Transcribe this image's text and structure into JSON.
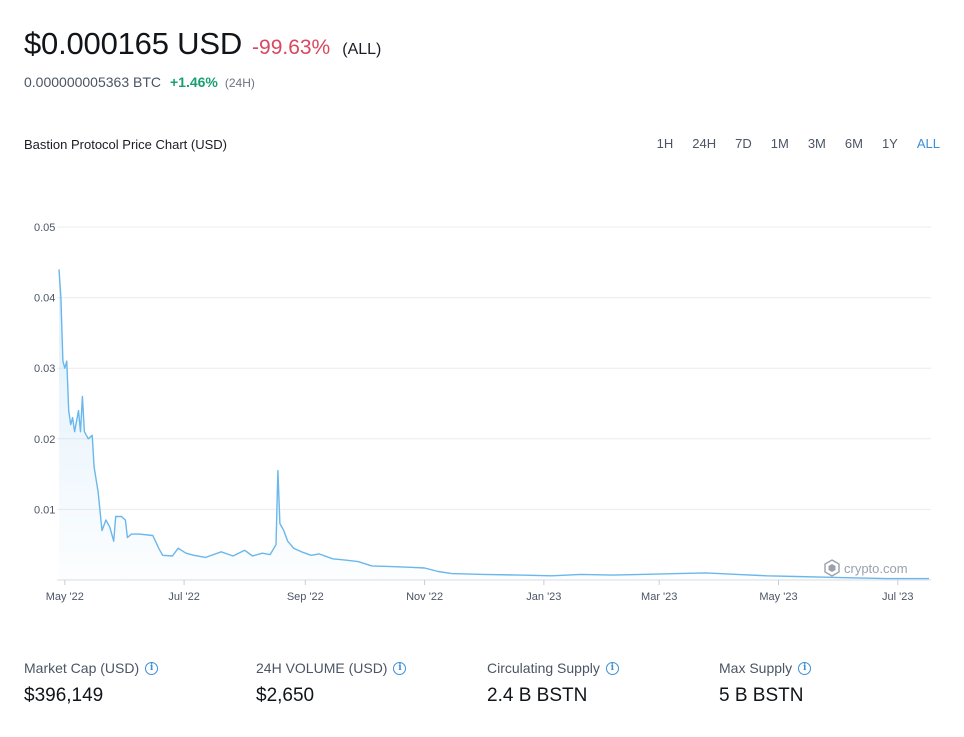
{
  "header": {
    "price": "$0.000165 USD",
    "change": "-99.63%",
    "change_period": "(ALL)",
    "btc_price": "0.000000005363 BTC",
    "btc_change": "+1.46%",
    "btc_period": "(24H)"
  },
  "chart_title": "Bastion Protocol Price Chart (USD)",
  "ranges": [
    "1H",
    "24H",
    "7D",
    "1M",
    "3M",
    "6M",
    "1Y",
    "ALL"
  ],
  "active_range": "ALL",
  "watermark": "crypto.com",
  "colors": {
    "line": "#6ab7ec",
    "accent": "#3a8fd8",
    "negative": "#d9485f",
    "positive": "#1a9f75"
  },
  "chart_data": {
    "type": "area",
    "ylim": [
      0,
      0.05
    ],
    "yticks": [
      0.01,
      0.02,
      0.03,
      0.04,
      0.05
    ],
    "ytick_labels": [
      "0.01",
      "0.02",
      "0.03",
      "0.04",
      "0.05"
    ],
    "xlim": [
      "2022-04-27",
      "2023-07-18"
    ],
    "xticks": [
      "2022-05-01",
      "2022-07-01",
      "2022-09-01",
      "2022-11-01",
      "2023-01-01",
      "2023-03-01",
      "2023-05-01",
      "2023-07-01"
    ],
    "xtick_labels": [
      "May '22",
      "Jul '22",
      "Sep '22",
      "Nov '22",
      "Jan '23",
      "Mar '23",
      "May '23",
      "Jul '23"
    ],
    "grid": true,
    "series": [
      {
        "points": [
          [
            "2022-04-28",
            0.044
          ],
          [
            "2022-04-29",
            0.04
          ],
          [
            "2022-04-30",
            0.031
          ],
          [
            "2022-05-01",
            0.03
          ],
          [
            "2022-05-02",
            0.031
          ],
          [
            "2022-05-03",
            0.024
          ],
          [
            "2022-05-04",
            0.022
          ],
          [
            "2022-05-05",
            0.023
          ],
          [
            "2022-05-06",
            0.021
          ],
          [
            "2022-05-08",
            0.024
          ],
          [
            "2022-05-09",
            0.021
          ],
          [
            "2022-05-10",
            0.026
          ],
          [
            "2022-05-11",
            0.021
          ],
          [
            "2022-05-13",
            0.02
          ],
          [
            "2022-05-15",
            0.0205
          ],
          [
            "2022-05-16",
            0.016
          ],
          [
            "2022-05-18",
            0.0125
          ],
          [
            "2022-05-20",
            0.007
          ],
          [
            "2022-05-22",
            0.0085
          ],
          [
            "2022-05-24",
            0.0075
          ],
          [
            "2022-05-26",
            0.0055
          ],
          [
            "2022-05-27",
            0.009
          ],
          [
            "2022-05-30",
            0.009
          ],
          [
            "2022-06-01",
            0.0085
          ],
          [
            "2022-06-02",
            0.006
          ],
          [
            "2022-06-04",
            0.0065
          ],
          [
            "2022-06-08",
            0.0065
          ],
          [
            "2022-06-15",
            0.0063
          ],
          [
            "2022-06-18",
            0.0045
          ],
          [
            "2022-06-20",
            0.0035
          ],
          [
            "2022-06-25",
            0.0034
          ],
          [
            "2022-06-28",
            0.0045
          ],
          [
            "2022-07-02",
            0.0038
          ],
          [
            "2022-07-06",
            0.0035
          ],
          [
            "2022-07-12",
            0.0032
          ],
          [
            "2022-07-20",
            0.004
          ],
          [
            "2022-07-26",
            0.0034
          ],
          [
            "2022-08-01",
            0.0042
          ],
          [
            "2022-08-05",
            0.0034
          ],
          [
            "2022-08-10",
            0.0038
          ],
          [
            "2022-08-14",
            0.0036
          ],
          [
            "2022-08-17",
            0.005
          ],
          [
            "2022-08-18",
            0.0155
          ],
          [
            "2022-08-19",
            0.008
          ],
          [
            "2022-08-21",
            0.007
          ],
          [
            "2022-08-23",
            0.0055
          ],
          [
            "2022-08-26",
            0.0045
          ],
          [
            "2022-08-30",
            0.004
          ],
          [
            "2022-09-04",
            0.0035
          ],
          [
            "2022-09-08",
            0.0037
          ],
          [
            "2022-09-15",
            0.003
          ],
          [
            "2022-09-22",
            0.0028
          ],
          [
            "2022-09-28",
            0.0026
          ],
          [
            "2022-10-05",
            0.002
          ],
          [
            "2022-10-15",
            0.0019
          ],
          [
            "2022-10-25",
            0.0018
          ],
          [
            "2022-11-01",
            0.0017
          ],
          [
            "2022-11-08",
            0.0012
          ],
          [
            "2022-11-15",
            0.0009
          ],
          [
            "2022-12-01",
            0.0008
          ],
          [
            "2022-12-20",
            0.0007
          ],
          [
            "2023-01-05",
            0.0006
          ],
          [
            "2023-01-20",
            0.0008
          ],
          [
            "2023-02-05",
            0.0007
          ],
          [
            "2023-02-20",
            0.0008
          ],
          [
            "2023-03-10",
            0.0009
          ],
          [
            "2023-03-25",
            0.001
          ],
          [
            "2023-04-10",
            0.0008
          ],
          [
            "2023-04-25",
            0.0006
          ],
          [
            "2023-05-10",
            0.0005
          ],
          [
            "2023-05-25",
            0.0004
          ],
          [
            "2023-06-10",
            0.0003
          ],
          [
            "2023-06-25",
            0.0002
          ],
          [
            "2023-07-10",
            0.0002
          ],
          [
            "2023-07-17",
            0.0002
          ]
        ]
      }
    ]
  },
  "stats": [
    {
      "label": "Market Cap (USD)",
      "value": "$396,149"
    },
    {
      "label": "24H VOLUME (USD)",
      "value": "$2,650"
    },
    {
      "label": "Circulating Supply",
      "value": "2.4 B BSTN"
    },
    {
      "label": "Max Supply",
      "value": "5 B BSTN"
    }
  ]
}
